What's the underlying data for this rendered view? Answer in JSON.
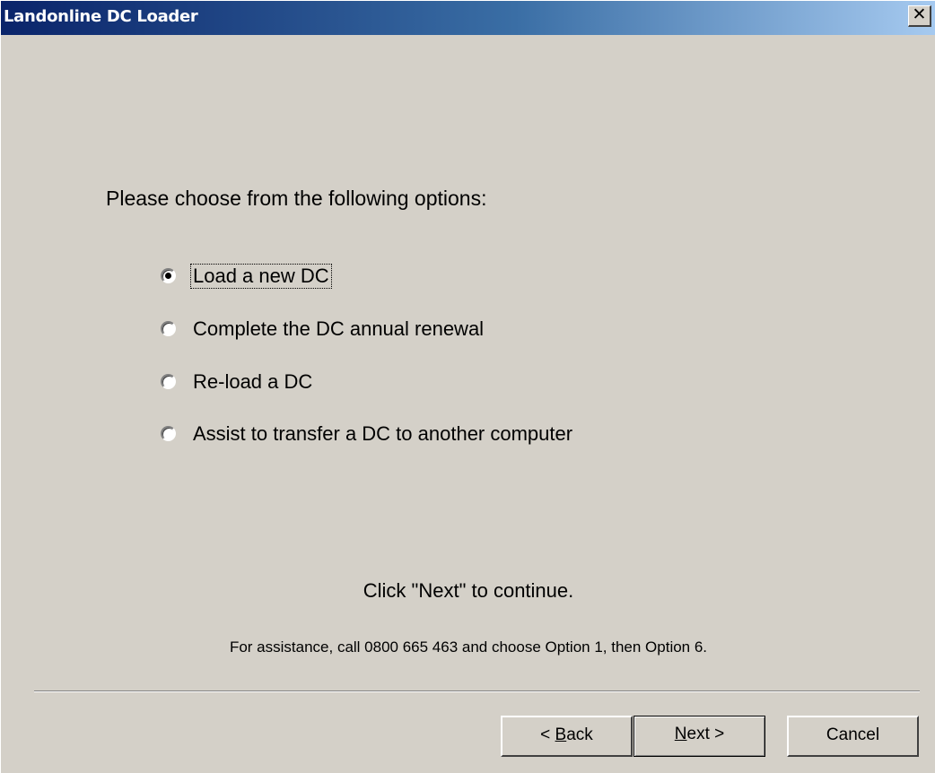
{
  "window": {
    "title": "Landonline DC Loader",
    "close_glyph": "✕"
  },
  "prompt": "Please choose from the following options:",
  "options": [
    {
      "label": "Load a new DC",
      "selected": true
    },
    {
      "label": "Complete the DC annual renewal",
      "selected": false
    },
    {
      "label": "Re-load a DC",
      "selected": false
    },
    {
      "label": "Assist to transfer a DC to another computer",
      "selected": false
    }
  ],
  "hint": "Click \"Next\" to continue.",
  "assistance": "For assistance, call 0800 665 463 and choose Option 1, then Option 6.",
  "buttons": {
    "back": {
      "prefix": "< ",
      "mnemonic": "B",
      "rest": "ack"
    },
    "next": {
      "prefix": "",
      "mnemonic": "N",
      "rest": "ext >"
    },
    "cancel": "Cancel"
  },
  "colors": {
    "face": "#d4d0c8",
    "titlebar_start": "#0a246a",
    "titlebar_end": "#a6caf0"
  },
  "icons": {
    "close": "close-icon",
    "radio_selected": "radio-selected-icon",
    "radio_unselected": "radio-unselected-icon"
  }
}
